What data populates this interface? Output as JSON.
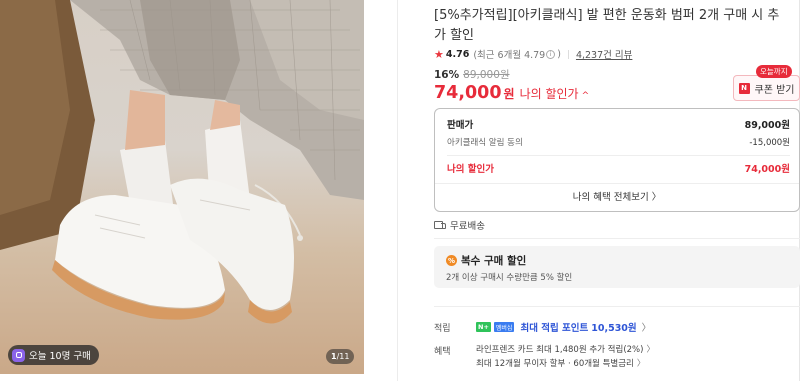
{
  "gallery": {
    "badge_text": "오늘 10명 구매",
    "counter_current": "1",
    "counter_total": "/11"
  },
  "product": {
    "title": "[5%추가적립][아키클래식] 발 편한 운동화 범퍼 2개 구매 시 추가 할인",
    "rating": {
      "score": "4.76",
      "recent": "(최근 6개월 4.79",
      "recent_close": ")",
      "info_glyph": "i",
      "reviews": "4,237건 리뷰"
    },
    "discount_pct": "16%",
    "original_price": "89,000원",
    "price": "74,000",
    "price_unit": "원",
    "my_price_label": "나의 할인가",
    "expand_glyph": "^"
  },
  "coupon": {
    "tag": "오늘까지",
    "icon": "N",
    "label": "쿠폰 받기"
  },
  "breakdown": {
    "rows": [
      {
        "label": "판매가",
        "value": "89,000원"
      },
      {
        "label": "아키클래식 알림 동의",
        "value": "-15,000원"
      },
      {
        "label": "나의 할인가",
        "value": "74,000원"
      }
    ],
    "more_label": "나의 혜택 전체보기 〉"
  },
  "shipping": {
    "label": "무료배송"
  },
  "bulk": {
    "icon": "%",
    "title": "복수 구매 할인",
    "desc": "2개 이상 구매시 수량만큼 5% 할인"
  },
  "points": {
    "label": "적립",
    "badge1": "N+",
    "badge2": "멤버십",
    "max_text": "최대 적립 포인트",
    "points": "10,530원",
    "chevron": "〉"
  },
  "benefits": {
    "label": "혜택",
    "line1": "라인프렌즈 카드 최대 1,480원 추가 적립(2%)",
    "line2": "최대 12개월 무이자 할부 · 60개월 특별금리",
    "chevron": "〉"
  },
  "colors": {
    "accent_red": "#e72b3a",
    "point_blue": "#2e55d6",
    "naverpay_green": "#2fc35a"
  }
}
